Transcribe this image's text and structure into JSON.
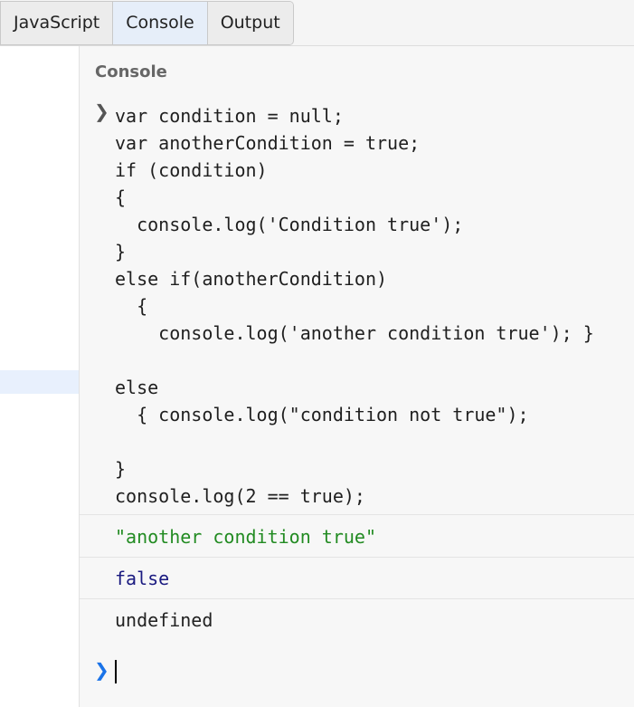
{
  "tabs": [
    {
      "label": "JavaScript"
    },
    {
      "label": "Console"
    },
    {
      "label": "Output"
    }
  ],
  "console": {
    "title": "Console",
    "prompt_symbol": "❯",
    "input_code": "var condition = null;\nvar anotherCondition = true;\nif (condition)\n{\n  console.log('Condition true');\n}\nelse if(anotherCondition)\n  {\n    console.log('another condition true'); }\n\nelse\n  { console.log(\"condition not true\");\n\n}\nconsole.log(2 == true);",
    "outputs": [
      {
        "text": "\"another condition true\"",
        "kind": "string"
      },
      {
        "text": "false",
        "kind": "boolean"
      },
      {
        "text": "undefined",
        "kind": "undefined"
      }
    ]
  },
  "colors": {
    "active_tab": "#e6eef9",
    "string_output": "#228b22",
    "boolean_output": "#1a1a80",
    "prompt_accent": "#1a73e8"
  }
}
